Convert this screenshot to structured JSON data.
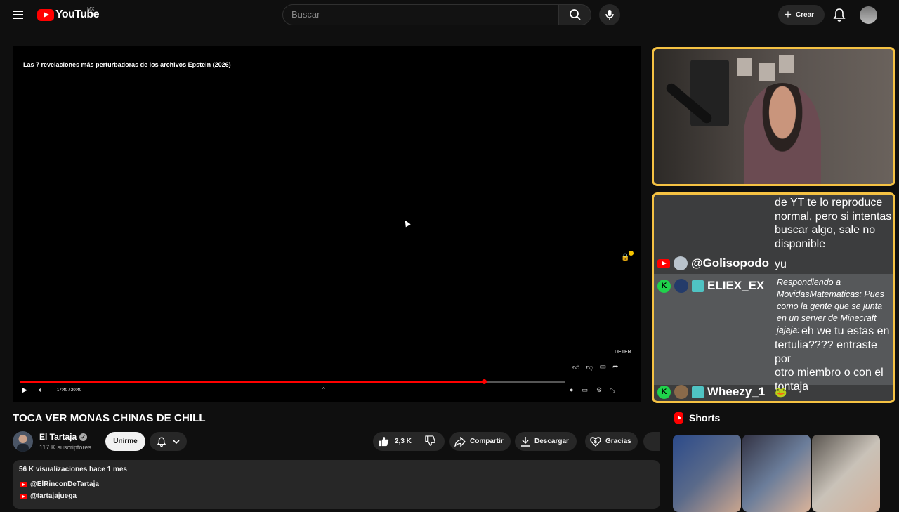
{
  "header": {
    "logo_text": "YouTube",
    "country_code": "MX",
    "search_placeholder": "Buscar",
    "create_label": "Crear"
  },
  "player": {
    "overlay_title": "Las 7 revelaciones más perturbadoras de los archivos Epstein (2026)",
    "watermark": "DETER",
    "time_display": "17:40 / 20:40",
    "progress_fraction": 0.852
  },
  "video": {
    "title": "TOCA VER MONAS CHINAS DE CHILL",
    "channel_name": "El Tartaja",
    "subscribers": "117 K suscriptores",
    "join_label": "Unirme",
    "like_count": "2,3 K",
    "share_label": "Compartir",
    "download_label": "Descargar",
    "thanks_label": "Gracias"
  },
  "description": {
    "meta": "56 K visualizaciones  hace 1 mes",
    "links": [
      "@ElRinconDeTartaja",
      "@tartajajuega"
    ]
  },
  "stream_chat": {
    "messages": [
      {
        "platform": "youtube",
        "user": "",
        "text_lines": [
          "de YT te lo reproduce",
          "normal, pero si intentas",
          "buscar algo, sale no",
          "disponible"
        ]
      },
      {
        "platform": "youtube",
        "user": "@Golisopodo",
        "text_lines": [
          "yu"
        ]
      },
      {
        "platform": "kick",
        "user": "ELIEX_EX",
        "reply_to": "Respondiendo a MovidasMatematicas: Pues como la gente que se junta en un server de Minecraft jajaja:",
        "text_lines": [
          "eh we tu estas en",
          "tertulia???? entraste por",
          "otro miembro o con el",
          "tontaja"
        ]
      },
      {
        "platform": "kick",
        "user": "Wheezy_1",
        "text_lines": [
          "🐸"
        ]
      }
    ]
  },
  "shorts": {
    "heading": "Shorts"
  },
  "colors": {
    "accent_red": "#ff0000",
    "stream_border": "#f5c243",
    "kick_green": "#1fd34b"
  }
}
